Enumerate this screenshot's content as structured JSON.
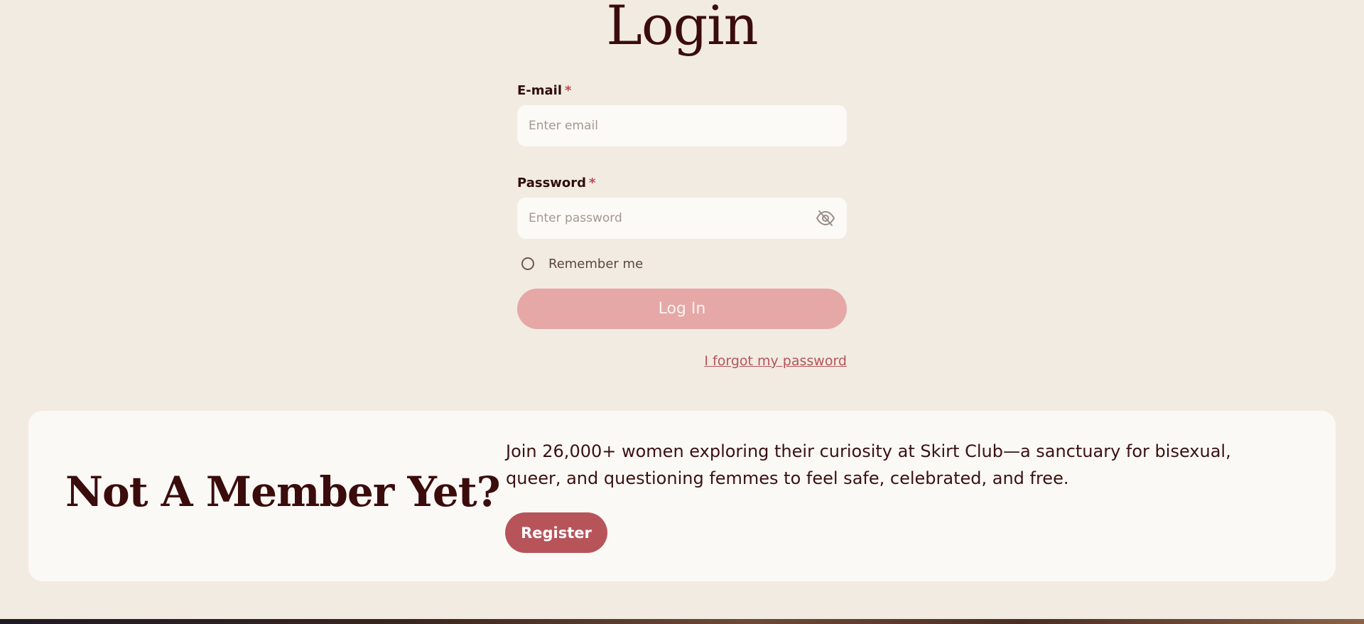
{
  "login": {
    "title": "Login",
    "email": {
      "label": "E-mail",
      "required_mark": "*",
      "placeholder": "Enter email",
      "value": ""
    },
    "password": {
      "label": "Password",
      "required_mark": "*",
      "placeholder": "Enter password",
      "value": ""
    },
    "remember_label": "Remember me",
    "submit_label": "Log In",
    "forgot_label": "I forgot my password"
  },
  "member": {
    "title": "Not A Member Yet?",
    "description": "Join 26,000+ women exploring their curiosity at Skirt Club—a sanctuary for bisexual, queer, and questioning femmes to feel safe, celebrated, and free.",
    "register_label": "Register"
  },
  "icons": {
    "password_toggle": "eye-off-icon"
  },
  "colors": {
    "background": "#f2ebe2",
    "heading": "#3b0c0c",
    "required": "#c0494f",
    "login_button": "#e5a8a7",
    "register_button": "#b7545a",
    "link": "#b5545a",
    "card": "#fbf9f6"
  }
}
